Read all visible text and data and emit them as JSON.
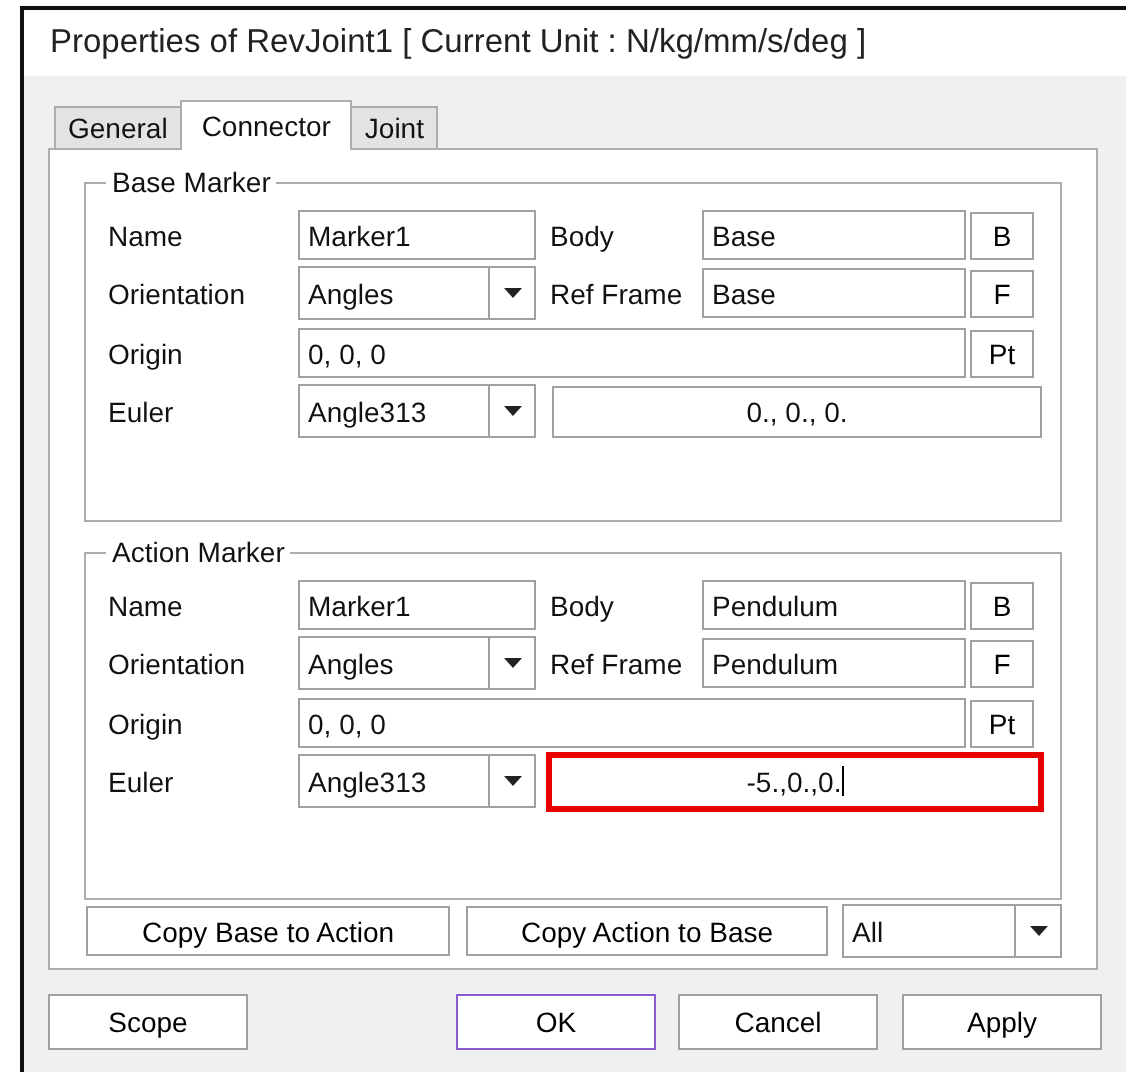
{
  "window": {
    "title": "Properties of RevJoint1 [ Current Unit : N/kg/mm/s/deg ]"
  },
  "tabs": [
    {
      "label": "General",
      "selected": false
    },
    {
      "label": "Connector",
      "selected": true
    },
    {
      "label": "Joint",
      "selected": false
    }
  ],
  "groups": [
    {
      "title": "Base Marker",
      "name_label": "Name",
      "name": "Marker1",
      "body_label": "Body",
      "body": "Base",
      "body_button": "B",
      "orientation_label": "Orientation",
      "orientation": "Angles",
      "ref_frame_label": "Ref Frame",
      "ref_frame": "Base",
      "ref_frame_button": "F",
      "origin_label": "Origin",
      "origin": "0, 0, 0",
      "origin_button": "Pt",
      "euler_label": "Euler",
      "euler_type": "Angle313",
      "euler_angles": "0., 0., 0.",
      "highlighted": false
    },
    {
      "title": "Action Marker",
      "name_label": "Name",
      "name": "Marker1",
      "body_label": "Body",
      "body": "Pendulum",
      "body_button": "B",
      "orientation_label": "Orientation",
      "orientation": "Angles",
      "ref_frame_label": "Ref Frame",
      "ref_frame": "Pendulum",
      "ref_frame_button": "F",
      "origin_label": "Origin",
      "origin": "0, 0, 0",
      "origin_button": "Pt",
      "euler_label": "Euler",
      "euler_type": "Angle313",
      "euler_angles": "-5.,0.,0.",
      "highlighted": true
    }
  ],
  "copy_buttons": [
    "Copy Base to Action",
    "Copy Action to Base"
  ],
  "copy_scope": "All",
  "buttons": [
    {
      "label": "Scope",
      "default": false
    },
    {
      "label": "OK",
      "default": true
    },
    {
      "label": "Cancel",
      "default": false
    },
    {
      "label": "Apply",
      "default": false
    }
  ]
}
